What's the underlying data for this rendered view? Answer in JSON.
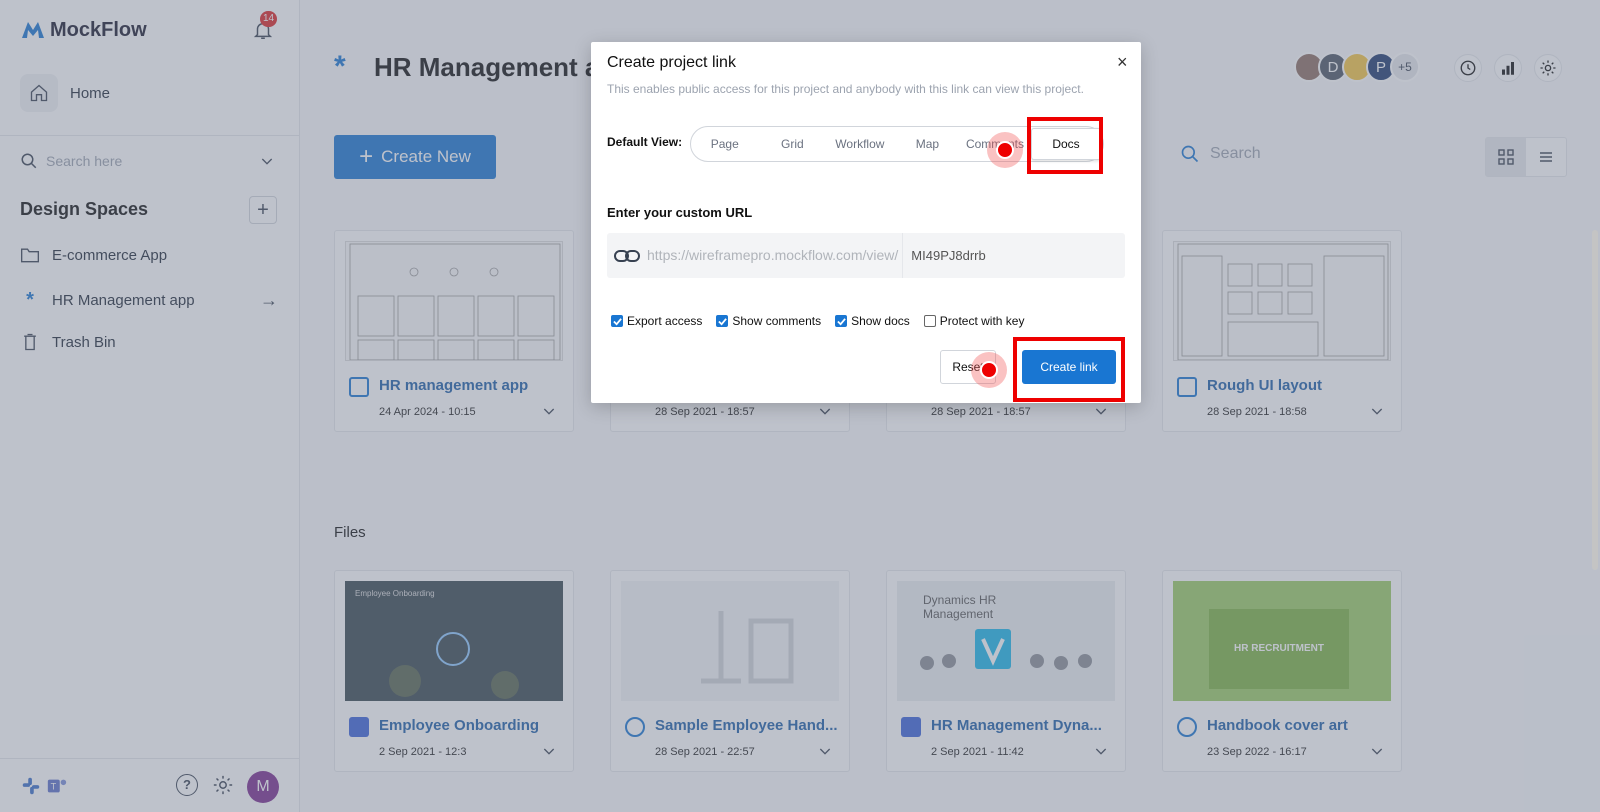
{
  "app": {
    "name": "MockFlow",
    "notifications": "14"
  },
  "sidebar": {
    "home": "Home",
    "search_placeholder": "Search here",
    "design_spaces_title": "Design Spaces",
    "items": [
      {
        "label": "E-commerce App",
        "icon": "folder-icon"
      },
      {
        "label": "HR Management app",
        "icon": "asterisk-icon"
      },
      {
        "label": "Trash Bin",
        "icon": "trash-icon"
      }
    ],
    "user_initial": "M"
  },
  "header": {
    "project_title": "HR Management app",
    "avatars": [
      "",
      "D",
      "",
      "P"
    ],
    "more_avatars": "+5"
  },
  "toolbar": {
    "create_new": "Create New",
    "search_placeholder": "Search"
  },
  "sections": {
    "files": "Files"
  },
  "projects": [
    {
      "title": "HR management app",
      "date": "24 Apr 2024 - 10:15"
    },
    {
      "title": "",
      "date": "28 Sep 2021 - 18:57"
    },
    {
      "title": "",
      "date": "28 Sep 2021 - 18:57"
    },
    {
      "title": "Rough UI layout",
      "date": "28 Sep 2021 - 18:58"
    }
  ],
  "files": [
    {
      "title": "Employee Onboarding",
      "date": "2 Sep 2021 - 12:3",
      "thumb_text": "Employee Onboarding"
    },
    {
      "title": "Sample Employee Hand...",
      "date": "28 Sep 2021 - 22:57"
    },
    {
      "title": "HR Management Dyna...",
      "date": "2 Sep 2021 - 11:42",
      "thumb_text": "Dynamics HR Management"
    },
    {
      "title": "Handbook cover art",
      "date": "23 Sep 2022 - 16:17",
      "thumb_text": "HR RECRUITMENT"
    }
  ],
  "modal": {
    "title": "Create project link",
    "close": "×",
    "subtitle": "This enables public access for this project and anybody with this link can view this project.",
    "default_view_label": "Default View:",
    "views": [
      "Page",
      "Grid",
      "Workflow",
      "Map",
      "Comments",
      "Docs"
    ],
    "selected_view": "Docs",
    "url_label": "Enter your custom URL",
    "url_prefix": "https://wireframepro.mockflow.com/view/",
    "url_slug": "MI49PJ8drrb",
    "checkboxes": [
      {
        "label": "Export access",
        "checked": true
      },
      {
        "label": "Show comments",
        "checked": true
      },
      {
        "label": "Show docs",
        "checked": true
      },
      {
        "label": "Protect with key",
        "checked": false
      }
    ],
    "reset": "Reset",
    "create": "Create link"
  },
  "colors": {
    "accent": "#1976d2",
    "highlight": "#ee0000"
  }
}
